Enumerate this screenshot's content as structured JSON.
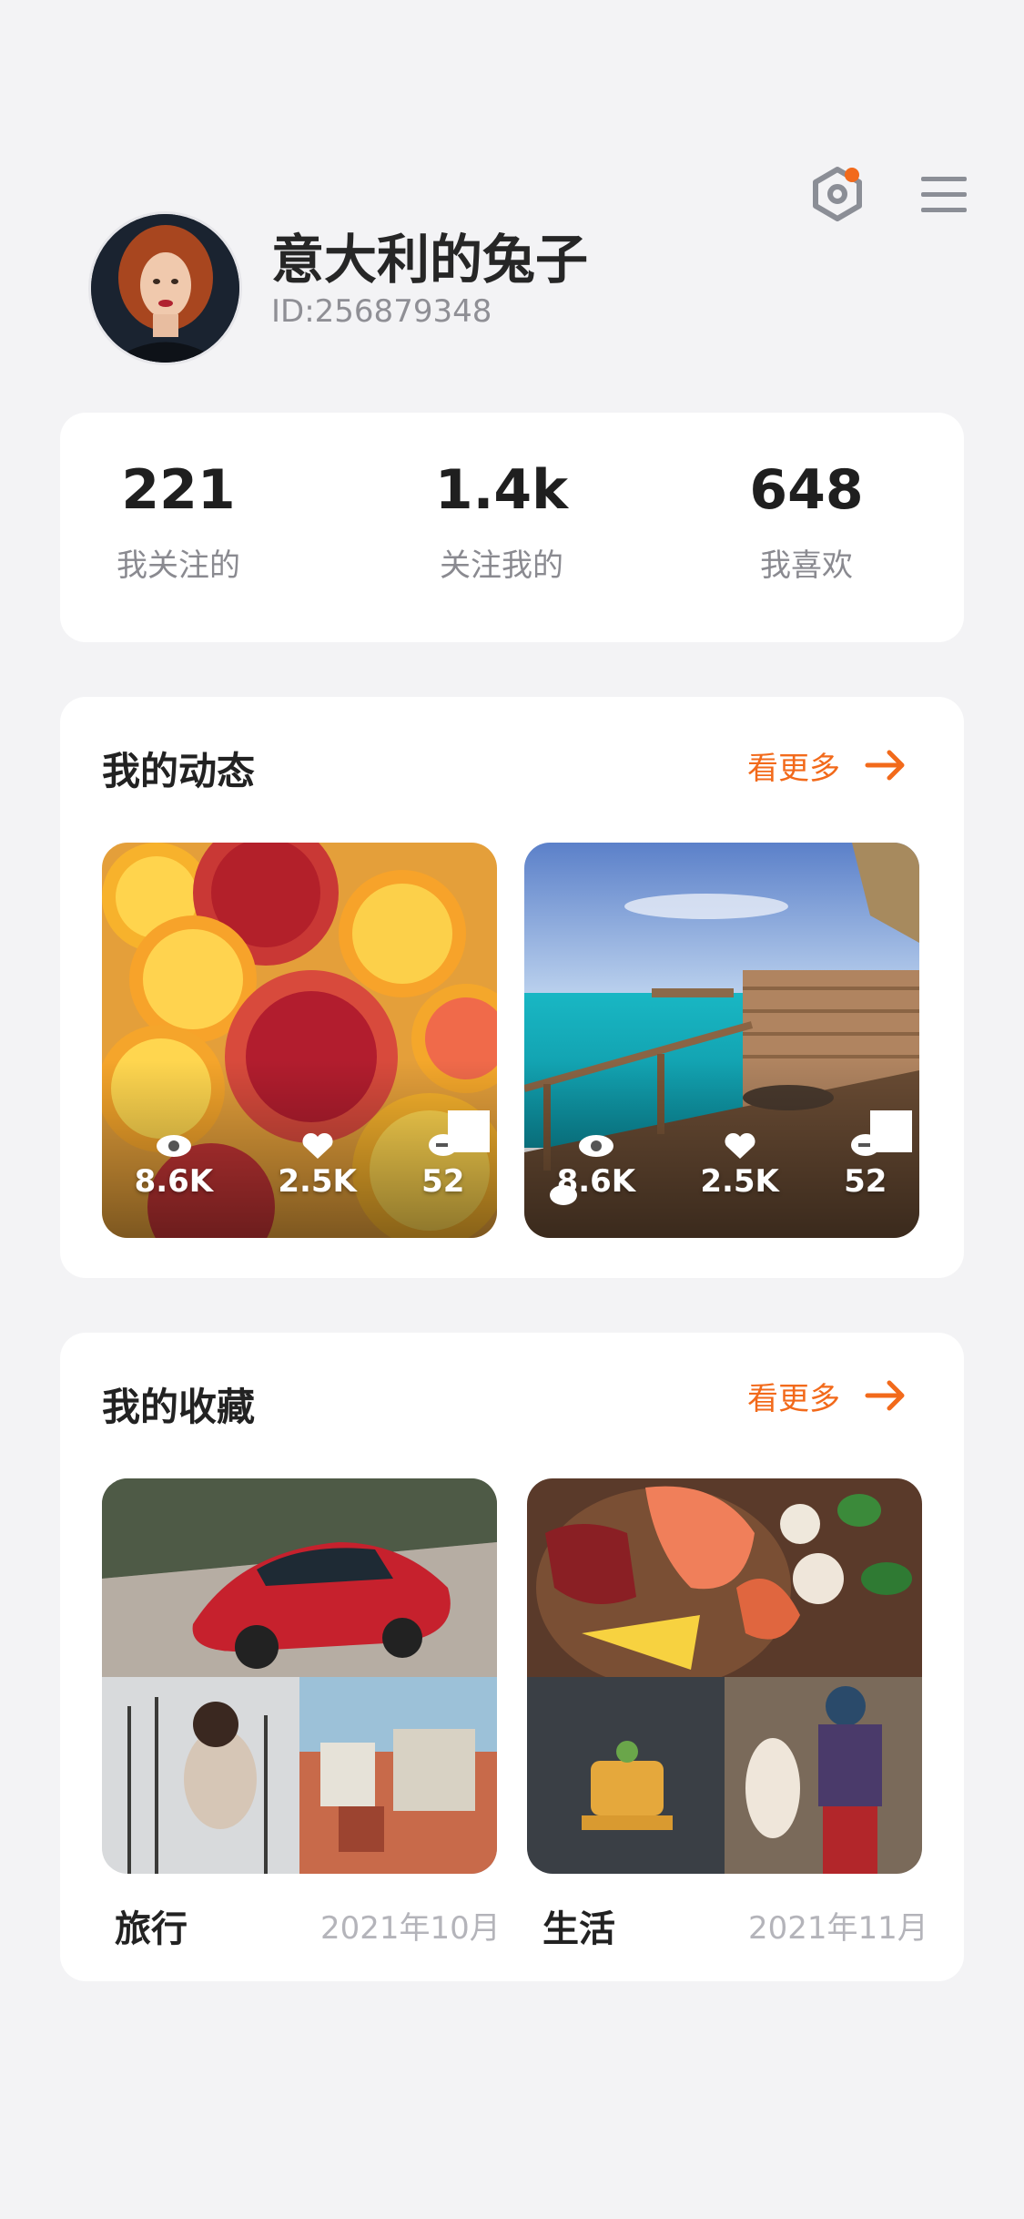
{
  "profile": {
    "name": "意大利的兔子",
    "id": "ID:256879348",
    "avatar": "avatar-woman-red-hair"
  },
  "header": {
    "settings_icon": "settings-hex-icon",
    "menu_icon": "menu-icon",
    "badge_color": "#f26a1b"
  },
  "stats": [
    {
      "value": "221",
      "label": "我关注的"
    },
    {
      "value": "1.4k",
      "label": "关注我的"
    },
    {
      "value": "648",
      "label": "我喜欢"
    }
  ],
  "dynamics": {
    "title": "我的动态",
    "more": "看更多",
    "posts": [
      {
        "image": "oranges-pomegranates",
        "views": "8.6K",
        "likes": "2.5K",
        "comments": "52"
      },
      {
        "image": "ocean-deck",
        "views": "8.6K",
        "likes": "2.5K",
        "comments": "52"
      }
    ]
  },
  "favorites": {
    "title": "我的收藏",
    "more": "看更多",
    "albums": [
      {
        "name": "旅行",
        "date": "2021年10月"
      },
      {
        "name": "生活",
        "date": "2021年11月"
      }
    ]
  },
  "colors": {
    "accent": "#f26a1b",
    "background": "#f3f3f5"
  }
}
